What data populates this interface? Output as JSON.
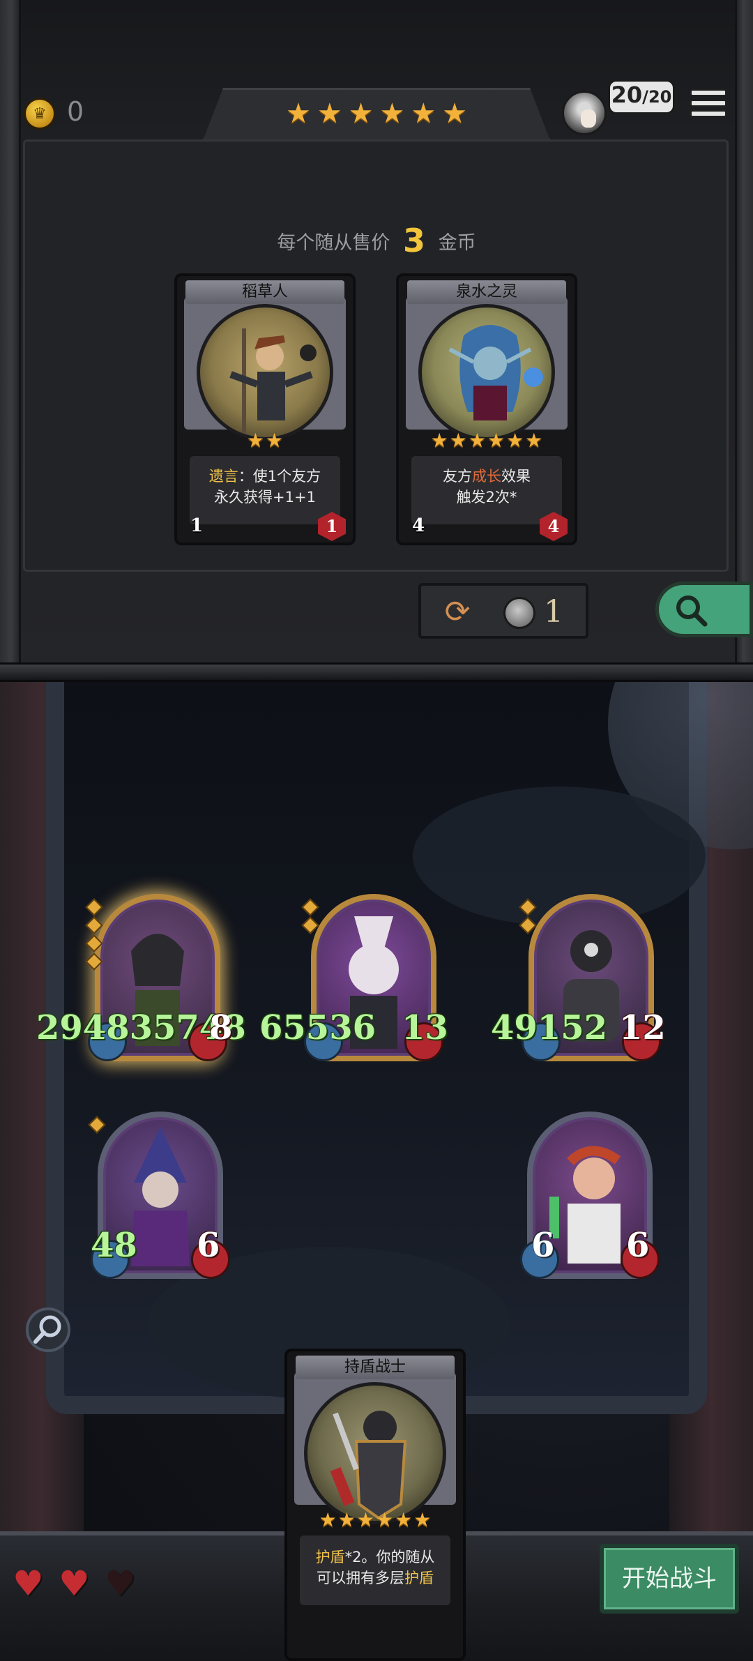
{
  "hud": {
    "gold": "0",
    "tier_stars": 6,
    "opponents_current": "20",
    "opponents_separator": "/",
    "opponents_max": "20"
  },
  "shop": {
    "price_prefix": "每个随从售价",
    "price_amount": "3",
    "price_suffix": "金币",
    "cards": [
      {
        "name": "稻草人",
        "stars": 2,
        "text_keyword": "遗言",
        "text_line1_rest": "：使1个友方",
        "text_line2": "永久获得+1+1",
        "attack": "1",
        "health": "1"
      },
      {
        "name": "泉水之灵",
        "stars": 6,
        "text_line1_pre": "友方",
        "text_keyword": "成长",
        "text_line1_post": "效果",
        "text_line2": "触发2次*",
        "attack": "4",
        "health": "4"
      }
    ],
    "refresh_cost": "1"
  },
  "board": {
    "minions": [
      {
        "attack": "294835748",
        "health": "8",
        "tier_pips": 4,
        "golden": true
      },
      {
        "attack": "65536",
        "health": "13",
        "tier_pips": 2,
        "golden": true
      },
      {
        "attack": "49152",
        "health": "12",
        "tier_pips": 2,
        "golden": true
      },
      {
        "attack": "48",
        "health": "6",
        "tier_pips": 1,
        "golden": false
      },
      {
        "attack": "6",
        "health": "6",
        "tier_pips": 0,
        "golden": false
      }
    ]
  },
  "hand": {
    "card": {
      "name": "持盾战士",
      "stars": 6,
      "keyword1": "护盾",
      "text_line1_rest": "*2。你的随从",
      "text_line2_pre": "可以拥有多层",
      "keyword2": "护盾"
    }
  },
  "player": {
    "lives_full": 2,
    "lives_total": 3
  },
  "buttons": {
    "start_battle": "开始战斗"
  },
  "colors": {
    "star": "#f2b13a",
    "keyword": "#f1c24a",
    "buff_number": "#b7f49a",
    "start_button": "#3b8b64",
    "health_gem": "#b4262e",
    "attack_gem": "#3b6ea0"
  },
  "icons": {
    "gold": "crown-coin-icon",
    "menu": "hamburger-icon",
    "refresh": "refresh-arrows-icon",
    "refresh_cost": "silver-coin-icon",
    "inspect": "magnifier-icon",
    "zoom": "magnifier-icon",
    "life": "heart-icon"
  }
}
